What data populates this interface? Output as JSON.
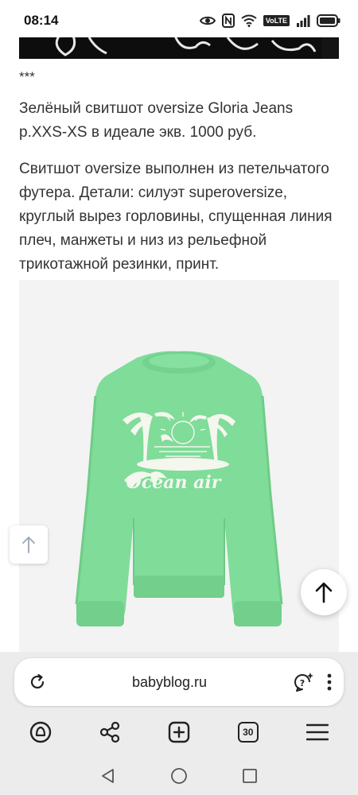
{
  "status_bar": {
    "time": "08:14",
    "icons": [
      "eye-icon",
      "nfc-icon",
      "wifi-icon",
      "volte-badge",
      "signal-icon",
      "battery-icon"
    ],
    "volte_label": "VoLTE"
  },
  "article": {
    "separator": "***",
    "title_line": "Зелёный свитшот oversize Gloria Jeans р.XXS-XS в идеале экв. 1000 руб.",
    "description": "Свитшот oversize выполнен из петельчатого футера. Детали: силуэт superoversize, круглый вырез горловины, спущенная линия плеч, манжеты и низ из рельефной трикотажной резинки, принт."
  },
  "product_image": {
    "print_text": "Ocean air",
    "sweatshirt_color": "#7fdc99",
    "background": "#f3f3f3"
  },
  "browser": {
    "url": "babyblog.ru",
    "tabs_count": "30"
  },
  "colors": {
    "text": "#333333",
    "panel": "#ececec"
  }
}
